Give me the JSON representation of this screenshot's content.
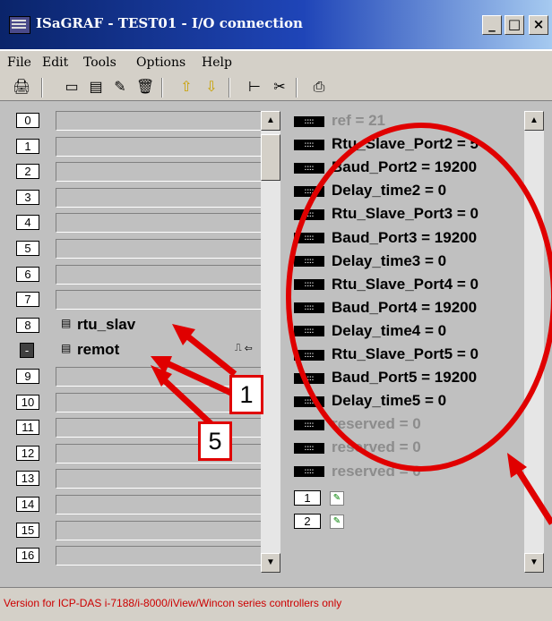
{
  "window": {
    "title": "ISaGRAF - TEST01 - I/O connection",
    "minimize": "_",
    "maximize": "□",
    "close": "×"
  },
  "menu": [
    "File",
    "Edit",
    "Tools",
    "Options",
    "Help"
  ],
  "slots": [
    {
      "num": "0",
      "label": ""
    },
    {
      "num": "1",
      "label": ""
    },
    {
      "num": "2",
      "label": ""
    },
    {
      "num": "3",
      "label": ""
    },
    {
      "num": "4",
      "label": ""
    },
    {
      "num": "5",
      "label": ""
    },
    {
      "num": "6",
      "label": ""
    },
    {
      "num": "7",
      "label": ""
    },
    {
      "num": "8",
      "label": "rtu_slav"
    },
    {
      "num": "-",
      "label": "remot"
    },
    {
      "num": "9",
      "label": ""
    },
    {
      "num": "10",
      "label": ""
    },
    {
      "num": "11",
      "label": ""
    },
    {
      "num": "12",
      "label": ""
    },
    {
      "num": "13",
      "label": ""
    },
    {
      "num": "14",
      "label": ""
    },
    {
      "num": "15",
      "label": ""
    },
    {
      "num": "16",
      "label": ""
    }
  ],
  "params": [
    {
      "text": "ref = 21",
      "grey": true
    },
    {
      "text": "Rtu_Slave_Port2 = 5",
      "grey": false
    },
    {
      "text": "Baud_Port2 = 19200",
      "grey": false
    },
    {
      "text": "Delay_time2 = 0",
      "grey": false
    },
    {
      "text": "Rtu_Slave_Port3 = 0",
      "grey": false
    },
    {
      "text": "Baud_Port3 = 19200",
      "grey": false
    },
    {
      "text": "Delay_time3 = 0",
      "grey": false
    },
    {
      "text": "Rtu_Slave_Port4 = 0",
      "grey": false
    },
    {
      "text": "Baud_Port4 = 19200",
      "grey": false
    },
    {
      "text": "Delay_time4 = 0",
      "grey": false
    },
    {
      "text": "Rtu_Slave_Port5 = 0",
      "grey": false
    },
    {
      "text": "Baud_Port5 = 19200",
      "grey": false
    },
    {
      "text": "Delay_time5 = 0",
      "grey": false
    },
    {
      "text": "reserved = 0",
      "grey": true
    },
    {
      "text": "reserved = 0",
      "grey": true
    },
    {
      "text": "reserved = 0",
      "grey": true
    }
  ],
  "channels": [
    "1",
    "2"
  ],
  "status": "Version for ICP-DAS i-7188/i-8000/iView/Wincon series controllers only",
  "callouts": [
    "1",
    "5"
  ],
  "colors": {
    "annotation": "#e00000",
    "title_start": "#0a246a",
    "title_end": "#a6caf0"
  }
}
